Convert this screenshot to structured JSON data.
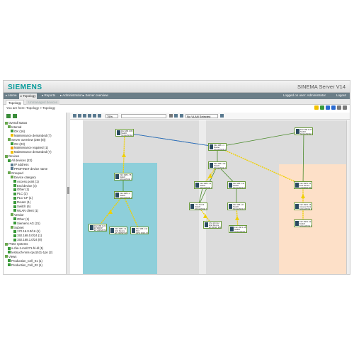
{
  "header": {
    "brand": "SIEMENS",
    "product": "SINEMA Server V14"
  },
  "menu": {
    "items": [
      "▸ Home",
      "▸ Topology",
      "▸ Reports",
      "▸ Administration",
      "▸ Server overview"
    ],
    "right": [
      "Logged on user: Administrator",
      "Logout"
    ]
  },
  "tabs": [
    "Topology",
    "Unmanaged devices"
  ],
  "breadcrumb": "You are here:  Topology > Topology",
  "map_toolbar": {
    "zoom": "75%",
    "vlan": "No VLAN Selected"
  },
  "tree": [
    {
      "label": "Overall status",
      "color": "#6aa84f"
    },
    {
      "label": "Internal",
      "color": "#6aa84f"
    },
    {
      "label": "OK (16)",
      "color": "#3a9a3a"
    },
    {
      "label": "Maintenance demanded (7)",
      "color": "#f0c000"
    },
    {
      "label": "Server overview (268 (8))",
      "color": "#6aa84f"
    },
    {
      "label": "OK (23)",
      "color": "#3a9a3a"
    },
    {
      "label": "Maintenance required (1)",
      "color": "#f0a000"
    },
    {
      "label": "Maintenance demanded (7)",
      "color": "#f0c000"
    },
    {
      "label": "Devices",
      "color": "#6aa84f"
    },
    {
      "label": "All devices (23)",
      "color": "#3a9a3a"
    },
    {
      "label": "IP address",
      "color": "#5a7a90"
    },
    {
      "label": "PROFINET device name",
      "color": "#5a7a90"
    },
    {
      "label": "Grouped",
      "color": "#6aa84f"
    },
    {
      "label": "Device category",
      "color": "#6aa84f"
    },
    {
      "label": "Access point (1)",
      "color": "#3a9a3a"
    },
    {
      "label": "End device (4)",
      "color": "#3a9a3a"
    },
    {
      "label": "Other (1)",
      "color": "#3a9a3a"
    },
    {
      "label": "PLC (2)",
      "color": "#3a9a3a"
    },
    {
      "label": "PLC-CP (1)",
      "color": "#3a9a3a"
    },
    {
      "label": "Router (1)",
      "color": "#3a9a3a"
    },
    {
      "label": "Switch (6)",
      "color": "#3a9a3a"
    },
    {
      "label": "WLAN client (1)",
      "color": "#3a9a3a"
    },
    {
      "label": "Vendor",
      "color": "#6aa84f"
    },
    {
      "label": "Other (1)",
      "color": "#3a9a3a"
    },
    {
      "label": "Siemens AG (21)",
      "color": "#3a9a3a"
    },
    {
      "label": "Subnet",
      "color": "#6aa84f"
    },
    {
      "label": "172.16.0.0/16 (1)",
      "color": "#3a9a3a"
    },
    {
      "label": "192.168.0.0/24 (1)",
      "color": "#3a9a3a"
    },
    {
      "label": "192.168.1.0/24 (8)",
      "color": "#3a9a3a"
    },
    {
      "label": "PNIO systems",
      "color": "#6aa84f"
    },
    {
      "label": "s-cfw-1-ms/271-hl-dl (1)",
      "color": "#3a9a3a"
    },
    {
      "label": "testsuch-mns-cpu1511-1pn (2)",
      "color": "#3a9a3a"
    },
    {
      "label": "Views",
      "color": "#6aa84f"
    },
    {
      "label": "Production_Cell_01 (1)",
      "color": "#3a9a3a"
    },
    {
      "label": "Production_Cell_02 (1)",
      "color": "#3a9a3a"
    }
  ],
  "devices": [
    {
      "l1": "192.168.0.88",
      "l2": "Switch",
      "l3": "SCALANCE X10..."
    },
    {
      "l1": "192.168.0.41",
      "l2": "Switch",
      "l3": "SCALANCE XC2..."
    },
    {
      "l1": "192.168.1.1",
      "l2": "Router",
      "l3": "SCALANCE XM4..."
    },
    {
      "l1": "192.168.1.60",
      "l2": "Switch",
      "l3": "SCALANCE XC2..."
    },
    {
      "l1": "192.168.1.31",
      "l2": "Switch",
      "l3": "SCALANCE XC2..."
    },
    {
      "l1": "192.168.1.14",
      "l2": "Switch",
      "l3": "SCALANCE XC2..."
    },
    {
      "l1": "192.168.1.75",
      "l2": "Switch",
      "l3": "SCALANCE XC2..."
    },
    {
      "l1": "192.168.1.2",
      "l2": "Switch",
      "l3": "SCALANCE XC2..."
    },
    {
      "l1": "192.168.0.22",
      "l2": "ET200SP",
      "l3": "ET 200SP IM1..."
    },
    {
      "l1": "172.16.0.5",
      "l2": "Switch",
      "l3": "SCALANCE XF1..."
    },
    {
      "l1": "172.16.0.12",
      "l2": "End Device",
      "l3": "ET200SP IM1..."
    },
    {
      "l1": "192.168.1.8",
      "l2": "Switch",
      "l3": "SCALANCE XF4..."
    },
    {
      "l1": "192.168.1.11",
      "l2": "End Device",
      "l3": "ET 200SP IM1..."
    },
    {
      "l1": "192.168.1.12",
      "l2": "PLC",
      "l3": "CPU 1516-3 P..."
    },
    {
      "l1": "192.168.1.31",
      "l2": "End Device",
      "l3": "ET200MP IM1..."
    },
    {
      "l1": "192.168.1.16",
      "l2": "Access Point",
      "l3": "SCALANCE W77..."
    },
    {
      "l1": "192.168.1.10",
      "l2": "Switch",
      "l3": "SCALANCE XF2..."
    },
    {
      "l1": "192.168.1.18",
      "l2": "Switch",
      "l3": "SCALANCE XF2..."
    }
  ],
  "colors": {
    "brand": "#009999",
    "menu": "#6b7e88",
    "area_blue": "#8ecfda",
    "area_orange": "#fde0c8",
    "area_gray": "#dcdcdc",
    "link_green": "#4a8a2a",
    "link_yellow": "#f0d000",
    "link_blue": "#2a6ad0"
  }
}
